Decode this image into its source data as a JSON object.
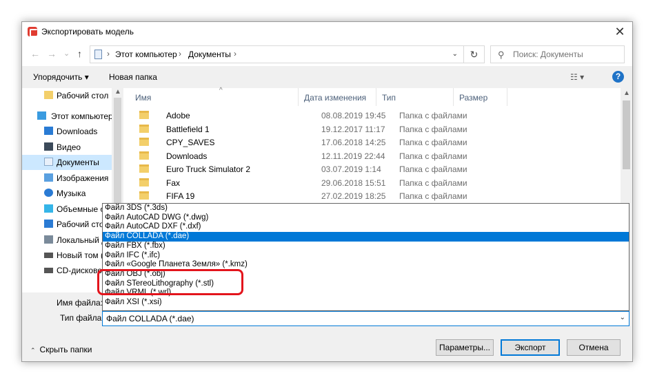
{
  "window": {
    "title": "Экспортировать модель",
    "close_glyph": "✕"
  },
  "address": {
    "back": "←",
    "forward": "→",
    "recent": "⌄",
    "up": "↑",
    "crumbs": [
      "Этот компьютер",
      "Документы"
    ],
    "sep": "›",
    "dropdown": "⌄",
    "refresh": "↻",
    "search_placeholder": "Поиск: Документы",
    "search_icon": "⚲"
  },
  "toolbar": {
    "organize": "Упорядочить ▾",
    "new_folder": "Новая папка",
    "view_icon": "☷ ▾",
    "help": "?"
  },
  "nav": {
    "items": [
      {
        "label": "Рабочий стол",
        "icon": "folder-icon",
        "color": "#f3cf6a"
      },
      {
        "label": "Этот компьютер",
        "icon": "computer-icon",
        "color": "#3a9be0"
      },
      {
        "label": "Downloads",
        "icon": "download-icon",
        "color": "#2a7bd4"
      },
      {
        "label": "Видео",
        "icon": "video-icon",
        "color": "#3c4a5a"
      },
      {
        "label": "Документы",
        "icon": "documents-icon",
        "color": "#8aa8c8"
      },
      {
        "label": "Изображения",
        "icon": "pictures-icon",
        "color": "#5aa0e0"
      },
      {
        "label": "Музыка",
        "icon": "music-icon",
        "color": "#2a7bd4"
      },
      {
        "label": "Объемные о",
        "icon": "3d-objects-icon",
        "color": "#35b5e8"
      },
      {
        "label": "Рабочий стол",
        "icon": "desktop-icon",
        "color": "#2a7bd4"
      },
      {
        "label": "Локальный д",
        "icon": "local-disk-icon",
        "color": "#7a8a9a"
      },
      {
        "label": "Новый том (E",
        "icon": "drive-icon",
        "color": "#555"
      },
      {
        "label": "CD-дисково",
        "icon": "cd-drive-icon",
        "color": "#555"
      }
    ],
    "selected_index": 4
  },
  "columns": {
    "name": "Имя",
    "date": "Дата изменения",
    "type": "Тип",
    "size": "Размер",
    "sort": "^"
  },
  "files": [
    {
      "name": "Adobe",
      "date": "08.08.2019 19:45",
      "type": "Папка с файлами"
    },
    {
      "name": "Battlefield 1",
      "date": "19.12.2017 11:17",
      "type": "Папка с файлами"
    },
    {
      "name": "CPY_SAVES",
      "date": "17.06.2018 14:25",
      "type": "Папка с файлами"
    },
    {
      "name": "Downloads",
      "date": "12.11.2019 22:44",
      "type": "Папка с файлами"
    },
    {
      "name": "Euro Truck Simulator 2",
      "date": "03.07.2019 1:14",
      "type": "Папка с файлами"
    },
    {
      "name": "Fax",
      "date": "29.06.2018 15:51",
      "type": "Папка с файлами"
    },
    {
      "name": "FIFA 19",
      "date": "27.02.2019 18:25",
      "type": "Папка с файлами"
    }
  ],
  "form": {
    "filename_label": "Имя файла:",
    "filetype_label": "Тип файла:",
    "filetype_value": "Файл COLLADA (*.dae)",
    "chevron": "⌄"
  },
  "dropdown": {
    "options": [
      "Файл 3DS (*.3ds)",
      "Файл AutoCAD DWG (*.dwg)",
      "Файл AutoCAD DXF (*.dxf)",
      "Файл COLLADA (*.dae)",
      "Файл FBX (*.fbx)",
      "Файл IFC (*.ifc)",
      "Файл «Google Планета Земля» (*.kmz)",
      "Файл OBJ (*.obj)",
      "Файл STereoLithography (*.stl)",
      "Файл VRML (*.wrl)",
      "Файл XSI (*.xsi)"
    ],
    "selected_index": 3
  },
  "footer": {
    "hide_folders": "Скрыть папки",
    "caret": "⌃",
    "params": "Параметры...",
    "export": "Экспорт",
    "cancel": "Отмена"
  }
}
